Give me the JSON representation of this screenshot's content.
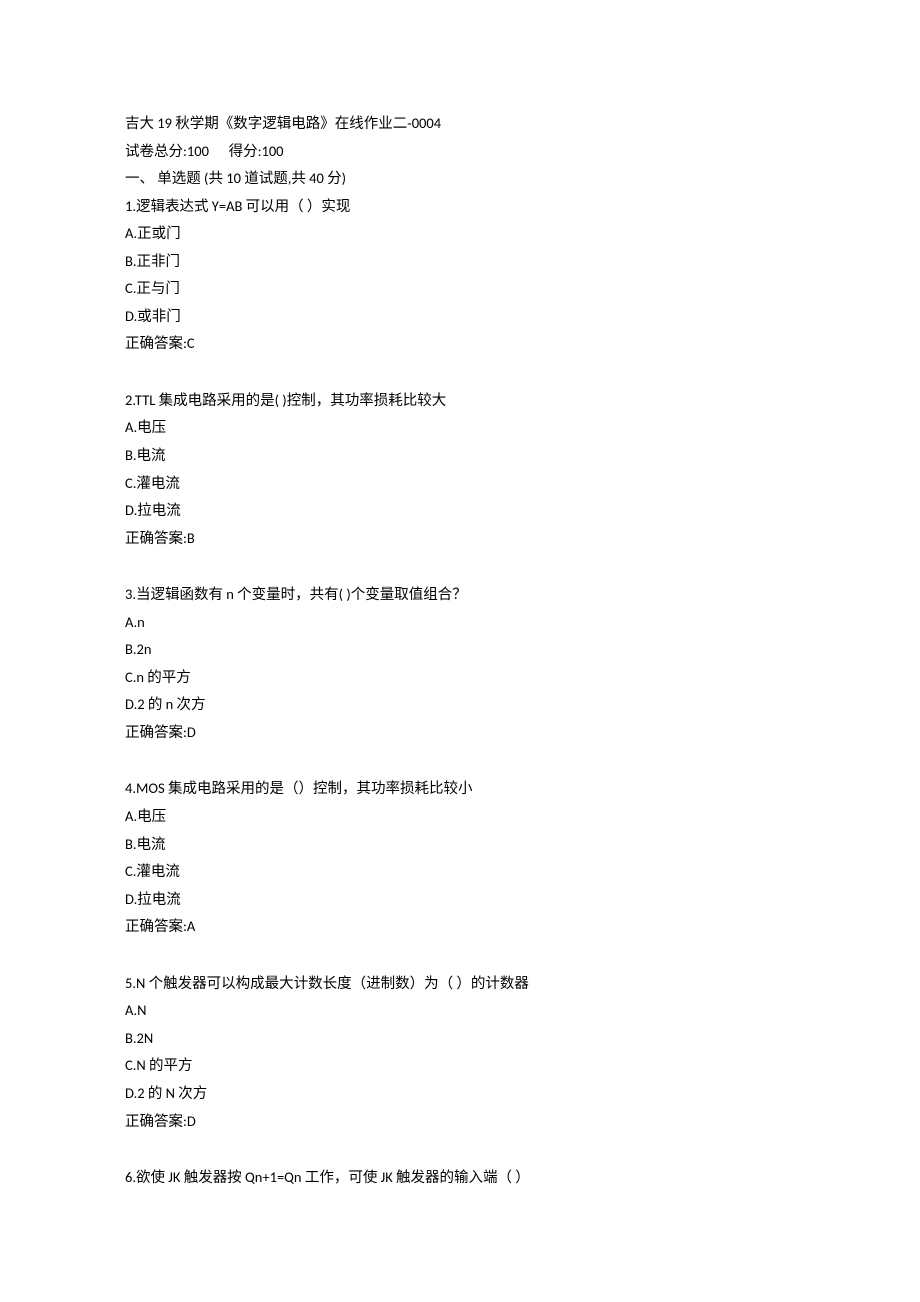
{
  "header": {
    "title": "吉大 19 秋学期《数字逻辑电路》在线作业二-0004",
    "score_line": "试卷总分:100      得分:100",
    "section_line": "一、 单选题 (共 10 道试题,共 40 分)"
  },
  "questions": [
    {
      "stem": "1.逻辑表达式 Y=AB 可以用（ ）实现",
      "options": [
        "A.正或门",
        "B.正非门",
        "C.正与门",
        "D.或非门"
      ],
      "answer": "正确答案:C"
    },
    {
      "stem": "2.TTL 集成电路采用的是( )控制，其功率损耗比较大",
      "options": [
        "A.电压",
        "B.电流",
        "C.灌电流",
        "D.拉电流"
      ],
      "answer": "正确答案:B"
    },
    {
      "stem": "3.当逻辑函数有 n 个变量时，共有( )个变量取值组合？",
      "options": [
        "A.n",
        "B.2n",
        "C.n 的平方",
        "D.2 的 n 次方"
      ],
      "answer": "正确答案:D"
    },
    {
      "stem": "4.MOS 集成电路采用的是（）控制，其功率损耗比较小",
      "options": [
        "A.电压",
        "B.电流",
        "C.灌电流",
        "D.拉电流"
      ],
      "answer": "正确答案:A"
    },
    {
      "stem": "5.N 个触发器可以构成最大计数长度（进制数）为（ ）的计数器",
      "options": [
        "A.N",
        "B.2N",
        "C.N 的平方",
        "D.2 的 N 次方"
      ],
      "answer": "正确答案:D"
    },
    {
      "stem": "6.欲使 JK 触发器按 Qn+1=Qn 工作，可使 JK 触发器的输入端（ ）",
      "options": [],
      "answer": ""
    }
  ]
}
